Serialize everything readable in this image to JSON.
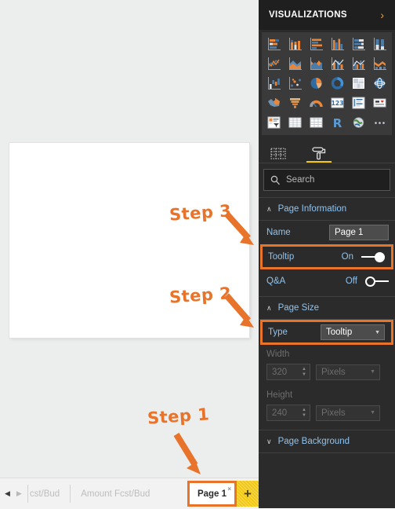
{
  "app": "Power BI Desktop",
  "report": {
    "canvas_label": "report-canvas-blank"
  },
  "tab_bar": {
    "prev_arrow": "◀",
    "next_arrow": "▶",
    "tabs": [
      {
        "label": "cst/Bud",
        "active": false
      },
      {
        "label": "Amount Fcst/Bud",
        "active": false
      }
    ],
    "active_tab": {
      "label": "Page 1",
      "close": "×"
    },
    "add_page_label": "+"
  },
  "viz_panel": {
    "title": "VISUALIZATIONS",
    "collapse_icon": "›",
    "gallery": [
      "stacked-bar-chart-icon",
      "stacked-column-chart-icon",
      "clustered-bar-chart-icon",
      "clustered-column-chart-icon",
      "100-stacked-bar-chart-icon",
      "100-stacked-column-chart-icon",
      "line-chart-icon",
      "area-chart-icon",
      "stacked-area-chart-icon",
      "line-and-stacked-column-chart-icon",
      "line-and-clustered-column-chart-icon",
      "ribbon-chart-icon",
      "waterfall-chart-icon",
      "scatter-chart-icon",
      "pie-chart-icon",
      "donut-chart-icon",
      "treemap-icon",
      "map-icon",
      "filled-map-icon",
      "funnel-icon",
      "gauge-icon",
      "card-icon",
      "multi-row-card-icon",
      "kpi-icon",
      "slicer-icon",
      "table-icon",
      "matrix-icon",
      "r-script-visual-icon",
      "arcgis-map-icon",
      "more-options-icon"
    ],
    "tabs": [
      {
        "name": "fields-tab",
        "icon": "fields-grid-icon",
        "selected": false
      },
      {
        "name": "format-tab",
        "icon": "paint-roller-icon",
        "selected": true
      }
    ],
    "search": {
      "icon": "search-icon",
      "placeholder": "Search",
      "value": ""
    },
    "sections": [
      {
        "id": "page-information",
        "title": "Page Information",
        "expanded": true,
        "chevron": "∧",
        "rows": [
          {
            "name": "name",
            "label": "Name",
            "control": "text",
            "value": "Page 1",
            "highlight": false
          },
          {
            "name": "tooltip",
            "label": "Tooltip",
            "control": "toggle",
            "value": "On",
            "highlight": true
          },
          {
            "name": "qna",
            "label": "Q&A",
            "control": "toggle",
            "value": "Off",
            "highlight": false
          }
        ]
      },
      {
        "id": "page-size",
        "title": "Page Size",
        "expanded": true,
        "chevron": "∧",
        "rows": [
          {
            "name": "type",
            "label": "Type",
            "control": "dropdown",
            "value": "Tooltip",
            "highlight": true
          },
          {
            "name": "width",
            "label": "Width",
            "control": "spinner",
            "value": "320",
            "unit": "Pixels",
            "disabled": true
          },
          {
            "name": "height",
            "label": "Height",
            "control": "spinner",
            "value": "240",
            "unit": "Pixels",
            "disabled": true
          }
        ]
      },
      {
        "id": "page-background",
        "title": "Page Background",
        "expanded": false,
        "chevron": "∨",
        "rows": []
      }
    ]
  },
  "annotations": [
    {
      "id": "step-3",
      "text": "Step 3"
    },
    {
      "id": "step-2",
      "text": "Step 2"
    },
    {
      "id": "step-1",
      "text": "Step 1"
    }
  ],
  "colors": {
    "annotation_orange": "#e8732a",
    "panel_background": "#2b2b2b",
    "panel_header": "#1f1f1f",
    "label_blue": "#8fc3ef",
    "accent_yellow": "#f2c811",
    "canvas_white": "#ffffff",
    "workspace_gray": "#eceded"
  }
}
